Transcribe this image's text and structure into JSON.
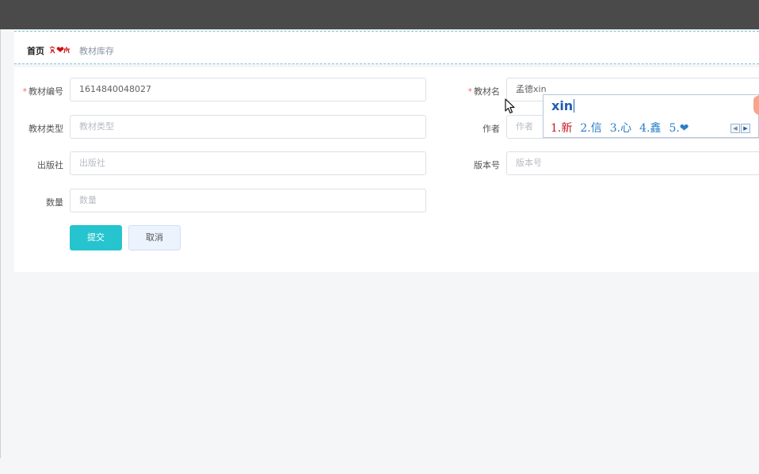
{
  "breadcrumb": {
    "home": "首页",
    "separator": "❤",
    "current": "教材库存"
  },
  "form": {
    "required_mark": "*",
    "code": {
      "label": "教材编号",
      "value": "1614840048027",
      "required": true
    },
    "name": {
      "label": "教材名",
      "value": "孟德xin",
      "required": true
    },
    "type": {
      "label": "教材类型",
      "placeholder": "教材类型"
    },
    "author": {
      "label": "作者",
      "placeholder": "作者"
    },
    "press": {
      "label": "出版社",
      "placeholder": "出版社"
    },
    "edition": {
      "label": "版本号",
      "placeholder": "版本号"
    },
    "quantity": {
      "label": "数量",
      "placeholder": "数量"
    },
    "submit_label": "提交",
    "cancel_label": "取消"
  },
  "ime": {
    "composition": "xin",
    "candidates": [
      "1.新",
      "2.信",
      "3.心",
      "4.鑫",
      "5.❤"
    ],
    "prev_icon": "triangle-left-icon",
    "next_icon": "triangle-right-icon"
  },
  "colors": {
    "topbar": "#4a4a4a",
    "accent": "#26c4cf",
    "required": "#f56c6c",
    "ime_first": "#c4161c",
    "ime_candidate": "#2a7ec8"
  }
}
